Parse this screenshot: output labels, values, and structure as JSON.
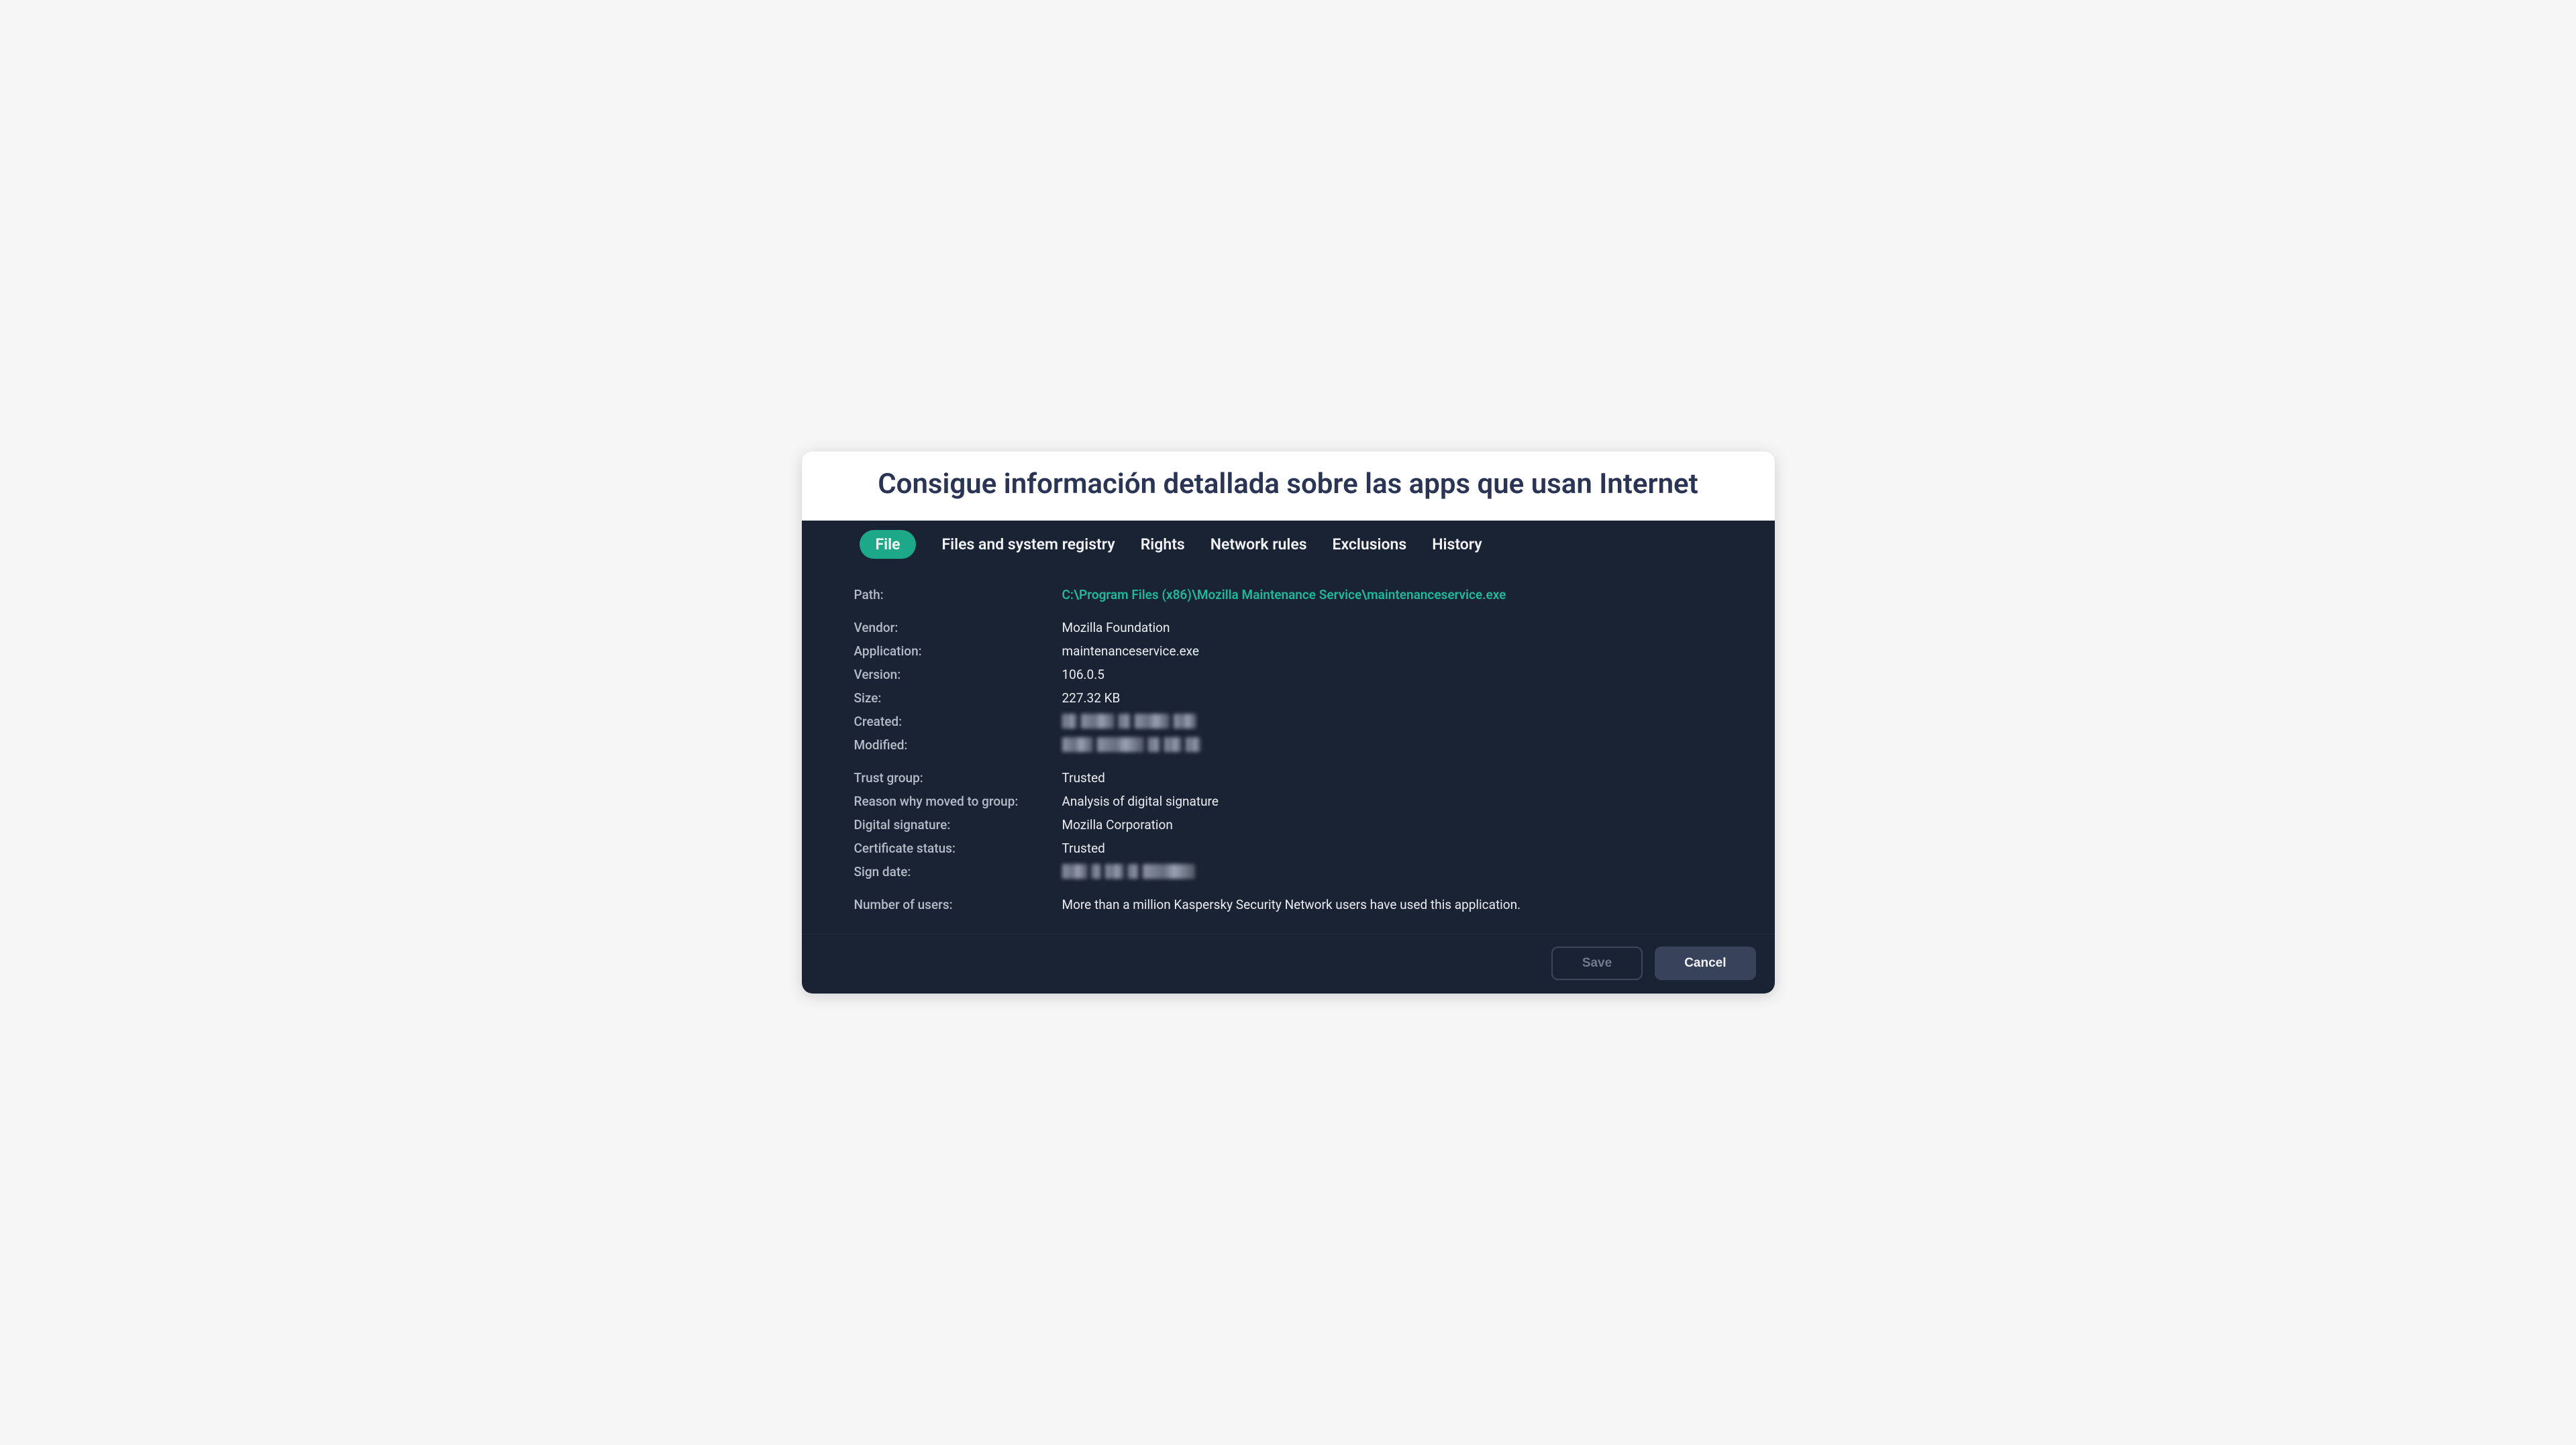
{
  "header": {
    "title": "Consigue información detallada sobre las apps que usan Internet"
  },
  "tabs": {
    "file": "File",
    "files_registry": "Files and system registry",
    "rights": "Rights",
    "network_rules": "Network rules",
    "exclusions": "Exclusions",
    "history": "History"
  },
  "fields": {
    "path_label": "Path:",
    "path_value": "C:\\Program Files (x86)\\Mozilla Maintenance Service\\maintenanceservice.exe",
    "vendor_label": "Vendor:",
    "vendor_value": "Mozilla Foundation",
    "application_label": "Application:",
    "application_value": "maintenanceservice.exe",
    "version_label": "Version:",
    "version_value": "106.0.5",
    "size_label": "Size:",
    "size_value": "227.32 KB",
    "created_label": "Created:",
    "created_value": "[redacted]",
    "modified_label": "Modified:",
    "modified_value": "[redacted]",
    "trust_group_label": "Trust group:",
    "trust_group_value": "Trusted",
    "reason_label": "Reason why moved to group:",
    "reason_value": "Analysis of digital signature",
    "digital_signature_label": "Digital signature:",
    "digital_signature_value": "Mozilla Corporation",
    "certificate_status_label": "Certificate status:",
    "certificate_status_value": "Trusted",
    "sign_date_label": "Sign date:",
    "sign_date_value": "[redacted]",
    "num_users_label": "Number of users:",
    "num_users_value": "More than a million Kaspersky Security Network users have used this application."
  },
  "footer": {
    "save": "Save",
    "cancel": "Cancel"
  }
}
